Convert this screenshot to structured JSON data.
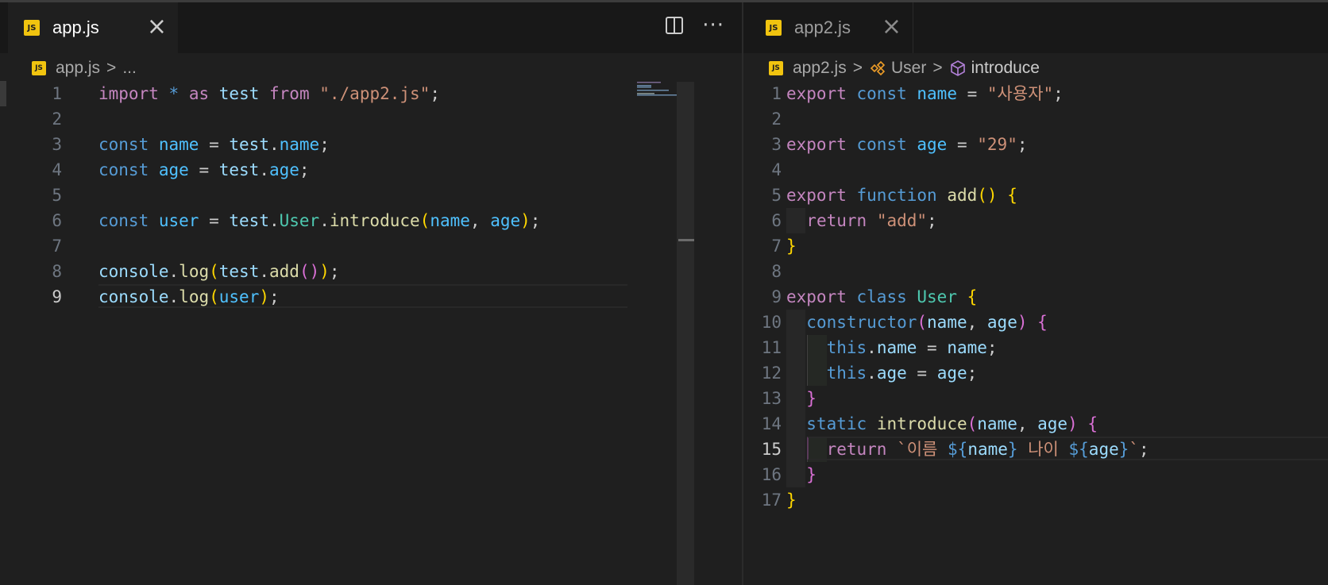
{
  "left_pane": {
    "tab": {
      "label": "app.js",
      "icon": "js-file-icon",
      "close": "×"
    },
    "actions": {
      "split_icon": "split-editor-icon",
      "more": "···"
    },
    "breadcrumb": {
      "file": "app.js",
      "sep": ">",
      "ellipsis": "..."
    },
    "lines": [
      {
        "n": "1",
        "tokens": [
          [
            "kw",
            "import"
          ],
          [
            "ws",
            " "
          ],
          [
            "st",
            "*"
          ],
          [
            "ws",
            " "
          ],
          [
            "kw",
            "as"
          ],
          [
            "ws",
            " "
          ],
          [
            "vr",
            "test"
          ],
          [
            "ws",
            " "
          ],
          [
            "kw",
            "from"
          ],
          [
            "ws",
            " "
          ],
          [
            "s",
            "\"./app2.js\""
          ],
          [
            "ws",
            ";"
          ]
        ]
      },
      {
        "n": "2",
        "tokens": []
      },
      {
        "n": "3",
        "tokens": [
          [
            "st",
            "const"
          ],
          [
            "ws",
            " "
          ],
          [
            "vr2",
            "name"
          ],
          [
            "ws",
            " = "
          ],
          [
            "vr",
            "test"
          ],
          [
            "ws",
            "."
          ],
          [
            "vr2",
            "name"
          ],
          [
            "ws",
            ";"
          ]
        ]
      },
      {
        "n": "4",
        "tokens": [
          [
            "st",
            "const"
          ],
          [
            "ws",
            " "
          ],
          [
            "vr2",
            "age"
          ],
          [
            "ws",
            " = "
          ],
          [
            "vr",
            "test"
          ],
          [
            "ws",
            "."
          ],
          [
            "vr2",
            "age"
          ],
          [
            "ws",
            ";"
          ]
        ]
      },
      {
        "n": "5",
        "tokens": []
      },
      {
        "n": "6",
        "tokens": [
          [
            "st",
            "const"
          ],
          [
            "ws",
            " "
          ],
          [
            "vr2",
            "user"
          ],
          [
            "ws",
            " = "
          ],
          [
            "vr",
            "test"
          ],
          [
            "ws",
            "."
          ],
          [
            "cl",
            "User"
          ],
          [
            "ws",
            "."
          ],
          [
            "fn",
            "introduce"
          ],
          [
            "p1",
            "("
          ],
          [
            "vr2",
            "name"
          ],
          [
            "ws",
            ", "
          ],
          [
            "vr2",
            "age"
          ],
          [
            "p1",
            ")"
          ],
          [
            "ws",
            ";"
          ]
        ]
      },
      {
        "n": "7",
        "tokens": []
      },
      {
        "n": "8",
        "tokens": [
          [
            "vr",
            "console"
          ],
          [
            "ws",
            "."
          ],
          [
            "fn",
            "log"
          ],
          [
            "p1",
            "("
          ],
          [
            "vr",
            "test"
          ],
          [
            "ws",
            "."
          ],
          [
            "fn",
            "add"
          ],
          [
            "p2",
            "()"
          ],
          [
            "p1",
            ")"
          ],
          [
            "ws",
            ";"
          ]
        ]
      },
      {
        "n": "9",
        "tokens": [
          [
            "vr",
            "console"
          ],
          [
            "ws",
            "."
          ],
          [
            "fn",
            "log"
          ],
          [
            "p1",
            "("
          ],
          [
            "vr2",
            "user"
          ],
          [
            "p1",
            ")"
          ],
          [
            "ws",
            ";"
          ]
        ],
        "active": true
      }
    ]
  },
  "right_pane": {
    "tab": {
      "label": "app2.js",
      "icon": "js-file-icon",
      "close": "×"
    },
    "breadcrumb": {
      "file": "app2.js",
      "sep": ">",
      "class_label": "User",
      "method_label": "introduce"
    },
    "lines": [
      {
        "n": "1",
        "tokens": [
          [
            "kw",
            "export"
          ],
          [
            "ws",
            " "
          ],
          [
            "st",
            "const"
          ],
          [
            "ws",
            " "
          ],
          [
            "vr2",
            "name"
          ],
          [
            "ws",
            " = "
          ],
          [
            "s",
            "\"사용자\""
          ],
          [
            "ws",
            ";"
          ]
        ]
      },
      {
        "n": "2",
        "tokens": []
      },
      {
        "n": "3",
        "tokens": [
          [
            "kw",
            "export"
          ],
          [
            "ws",
            " "
          ],
          [
            "st",
            "const"
          ],
          [
            "ws",
            " "
          ],
          [
            "vr2",
            "age"
          ],
          [
            "ws",
            " = "
          ],
          [
            "s",
            "\"29\""
          ],
          [
            "ws",
            ";"
          ]
        ]
      },
      {
        "n": "4",
        "tokens": []
      },
      {
        "n": "5",
        "tokens": [
          [
            "kw",
            "export"
          ],
          [
            "ws",
            " "
          ],
          [
            "st",
            "function"
          ],
          [
            "ws",
            " "
          ],
          [
            "fn",
            "add"
          ],
          [
            "p1",
            "()"
          ],
          [
            "ws",
            " "
          ],
          [
            "p1",
            "{"
          ]
        ]
      },
      {
        "n": "6",
        "tokens": [
          [
            "ws",
            "  "
          ],
          [
            "kw",
            "return"
          ],
          [
            "ws",
            " "
          ],
          [
            "s",
            "\"add\""
          ],
          [
            "ws",
            ";"
          ]
        ]
      },
      {
        "n": "7",
        "tokens": [
          [
            "p1",
            "}"
          ]
        ]
      },
      {
        "n": "8",
        "tokens": []
      },
      {
        "n": "9",
        "tokens": [
          [
            "kw",
            "export"
          ],
          [
            "ws",
            " "
          ],
          [
            "st",
            "class"
          ],
          [
            "ws",
            " "
          ],
          [
            "cl",
            "User"
          ],
          [
            "ws",
            " "
          ],
          [
            "p1",
            "{"
          ]
        ]
      },
      {
        "n": "10",
        "tokens": [
          [
            "ws",
            "  "
          ],
          [
            "st",
            "constructor"
          ],
          [
            "p2",
            "("
          ],
          [
            "vr",
            "name"
          ],
          [
            "ws",
            ", "
          ],
          [
            "vr",
            "age"
          ],
          [
            "p2",
            ")"
          ],
          [
            "ws",
            " "
          ],
          [
            "p2",
            "{"
          ]
        ]
      },
      {
        "n": "11",
        "tokens": [
          [
            "ws",
            "    "
          ],
          [
            "st",
            "this"
          ],
          [
            "ws",
            "."
          ],
          [
            "vr",
            "name"
          ],
          [
            "ws",
            " = "
          ],
          [
            "vr",
            "name"
          ],
          [
            "ws",
            ";"
          ]
        ]
      },
      {
        "n": "12",
        "tokens": [
          [
            "ws",
            "    "
          ],
          [
            "st",
            "this"
          ],
          [
            "ws",
            "."
          ],
          [
            "vr",
            "age"
          ],
          [
            "ws",
            " = "
          ],
          [
            "vr",
            "age"
          ],
          [
            "ws",
            ";"
          ]
        ]
      },
      {
        "n": "13",
        "tokens": [
          [
            "ws",
            "  "
          ],
          [
            "p2",
            "}"
          ]
        ]
      },
      {
        "n": "14",
        "tokens": [
          [
            "ws",
            "  "
          ],
          [
            "st",
            "static"
          ],
          [
            "ws",
            " "
          ],
          [
            "fn",
            "introduce"
          ],
          [
            "p2",
            "("
          ],
          [
            "vr",
            "name"
          ],
          [
            "ws",
            ", "
          ],
          [
            "vr",
            "age"
          ],
          [
            "p2",
            ")"
          ],
          [
            "ws",
            " "
          ],
          [
            "p2",
            "{"
          ]
        ]
      },
      {
        "n": "15",
        "tokens": [
          [
            "ws",
            "    "
          ],
          [
            "kw",
            "return"
          ],
          [
            "ws",
            " "
          ],
          [
            "s",
            "`이름 "
          ],
          [
            "st",
            "${"
          ],
          [
            "vr",
            "name"
          ],
          [
            "st",
            "}"
          ],
          [
            "s",
            " 나이 "
          ],
          [
            "st",
            "${"
          ],
          [
            "vr",
            "age"
          ],
          [
            "st",
            "}"
          ],
          [
            "s",
            "`"
          ],
          [
            "ws",
            ";"
          ]
        ],
        "active": true
      },
      {
        "n": "16",
        "tokens": [
          [
            "ws",
            "  "
          ],
          [
            "p2",
            "}"
          ]
        ]
      },
      {
        "n": "17",
        "tokens": [
          [
            "p1",
            "}"
          ]
        ]
      }
    ]
  }
}
